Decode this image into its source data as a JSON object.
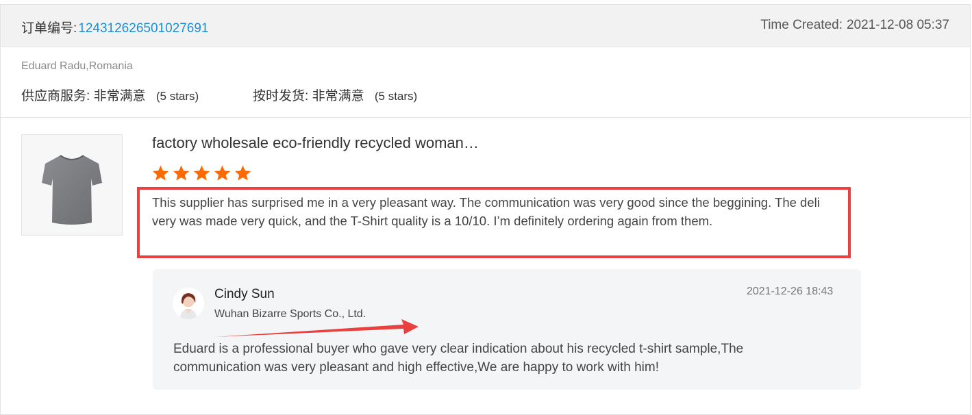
{
  "order": {
    "number_label": "订单编号:",
    "number_value": "124312626501027691",
    "time_label": "Time Created:",
    "time_value": "2021-12-08 05:37"
  },
  "buyer": {
    "name_location": "Eduard Radu,Romania",
    "ratings": [
      {
        "label": "供应商服务:",
        "value": "非常满意",
        "stars_text": "(5 stars)"
      },
      {
        "label": "按时发货:",
        "value": "非常满意",
        "stars_text": "(5 stars)"
      }
    ]
  },
  "product": {
    "image_icon": "tshirt-image",
    "title": "factory wholesale eco-friendly recycled woman…",
    "rating": 5,
    "star_color": "#ff6a00"
  },
  "review": {
    "text": "This supplier has surprised me in a very pleasant way. The communication was very good since the beggining. The delivery was made very quick, and the T-Shirt quality is a 10/10. I’m definitely ordering again from them.",
    "highlight_color": "#e8413f"
  },
  "reply": {
    "author": "Cindy Sun",
    "company": "Wuhan Bizarre Sports Co., Ltd.",
    "date": "2021-12-26 18:43",
    "text": "Eduard is a professional buyer who gave very clear indication about his recycled t-shirt sample,The communication was very pleasant and high effective,We are happy to work with him!",
    "avatar_icon": "person-avatar"
  }
}
